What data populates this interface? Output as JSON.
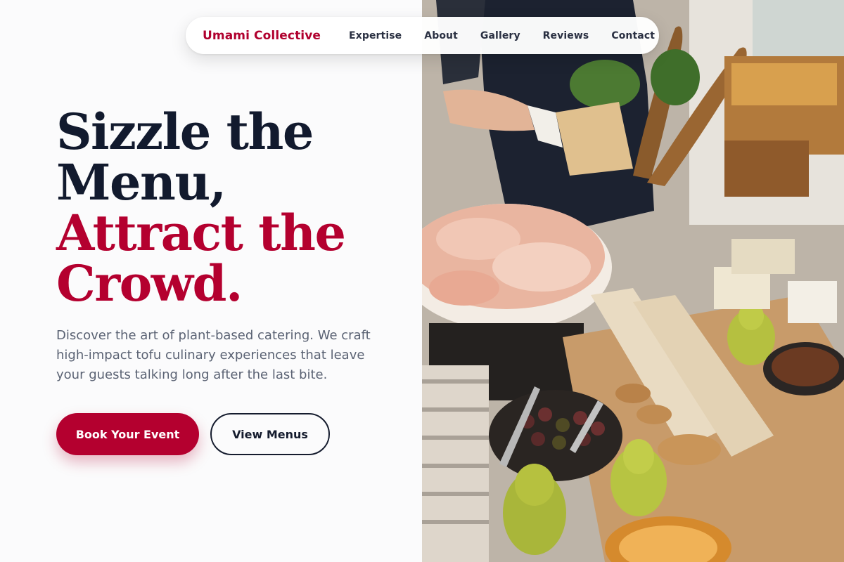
{
  "nav": {
    "brand": "Umami Collective",
    "links": [
      "Expertise",
      "About",
      "Gallery",
      "Reviews",
      "Contact"
    ]
  },
  "hero": {
    "title_dark_1": "Sizzle the",
    "title_dark_2": "Menu,",
    "title_red_1": "Attract the",
    "title_red_2": "Crowd.",
    "subtitle": "Discover the art of plant-based catering. We craft high-impact tofu culinary experiences that leave your guests talking long after the last bite.",
    "primary_button": "Book Your Event",
    "secondary_button": "View Menus"
  },
  "colors": {
    "accent": "#b4002f",
    "heading": "#121a2e",
    "body_text": "#5a6273",
    "background": "#fbfbfc"
  }
}
